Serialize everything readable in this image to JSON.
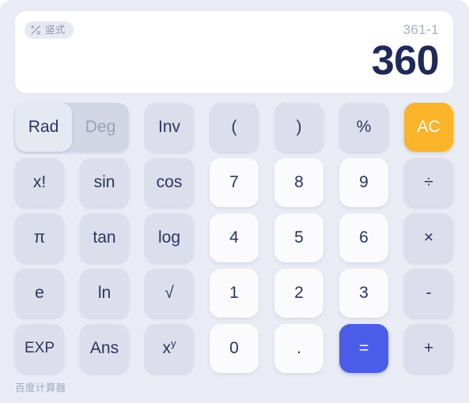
{
  "app": {
    "footer_label": "百度计算器"
  },
  "display": {
    "mode_badge": {
      "icon": "math-operations-icon",
      "label": "竖式"
    },
    "expression": "361-1",
    "result": "360"
  },
  "angle_mode": {
    "options": [
      {
        "label": "Rad",
        "selected": true
      },
      {
        "label": "Deg",
        "selected": false
      }
    ]
  },
  "keypad": {
    "rows": [
      {
        "keys": [
          {
            "label": "Inv",
            "name": "key-inv",
            "style": "function"
          },
          {
            "label": "(",
            "name": "key-open-paren",
            "style": "function"
          },
          {
            "label": ")",
            "name": "key-close-paren",
            "style": "function"
          },
          {
            "label": "%",
            "name": "key-percent",
            "style": "function"
          },
          {
            "label": "AC",
            "name": "key-all-clear",
            "style": "accent-ac"
          }
        ]
      },
      {
        "keys": [
          {
            "label": "x!",
            "name": "key-factorial",
            "style": "function"
          },
          {
            "label": "sin",
            "name": "key-sin",
            "style": "function"
          },
          {
            "label": "cos",
            "name": "key-cos",
            "style": "function"
          },
          {
            "label": "7",
            "name": "key-7",
            "style": "num"
          },
          {
            "label": "8",
            "name": "key-8",
            "style": "num"
          },
          {
            "label": "9",
            "name": "key-9",
            "style": "num"
          },
          {
            "label": "÷",
            "name": "key-divide",
            "style": "function"
          }
        ]
      },
      {
        "keys": [
          {
            "label": "π",
            "name": "key-pi",
            "style": "function"
          },
          {
            "label": "tan",
            "name": "key-tan",
            "style": "function"
          },
          {
            "label": "log",
            "name": "key-log",
            "style": "function"
          },
          {
            "label": "4",
            "name": "key-4",
            "style": "num"
          },
          {
            "label": "5",
            "name": "key-5",
            "style": "num"
          },
          {
            "label": "6",
            "name": "key-6",
            "style": "num"
          },
          {
            "label": "×",
            "name": "key-multiply",
            "style": "function"
          }
        ]
      },
      {
        "keys": [
          {
            "label": "e",
            "name": "key-e",
            "style": "function"
          },
          {
            "label": "ln",
            "name": "key-ln",
            "style": "function"
          },
          {
            "label": "√",
            "name": "key-square-root",
            "style": "function"
          },
          {
            "label": "1",
            "name": "key-1",
            "style": "num"
          },
          {
            "label": "2",
            "name": "key-2",
            "style": "num"
          },
          {
            "label": "3",
            "name": "key-3",
            "style": "num"
          },
          {
            "label": "-",
            "name": "key-minus",
            "style": "function"
          }
        ]
      },
      {
        "keys": [
          {
            "label": "EXP",
            "name": "key-exp",
            "style": "function-small"
          },
          {
            "label": "Ans",
            "name": "key-ans",
            "style": "function"
          },
          {
            "label": "x^y",
            "name": "key-power",
            "style": "function-power"
          },
          {
            "label": "0",
            "name": "key-0",
            "style": "num"
          },
          {
            "label": ".",
            "name": "key-decimal",
            "style": "num"
          },
          {
            "label": "=",
            "name": "key-equals",
            "style": "accent-eq"
          },
          {
            "label": "+",
            "name": "key-plus",
            "style": "function"
          }
        ]
      }
    ]
  },
  "colors": {
    "background": "#e9ecf5",
    "key": "#dcdfeb",
    "key_number": "#fbfbfd",
    "accent_clear": "#fcb42a",
    "accent_equals": "#4a5de8",
    "result_text": "#1f2a58",
    "expression_text": "#a9aec4"
  }
}
